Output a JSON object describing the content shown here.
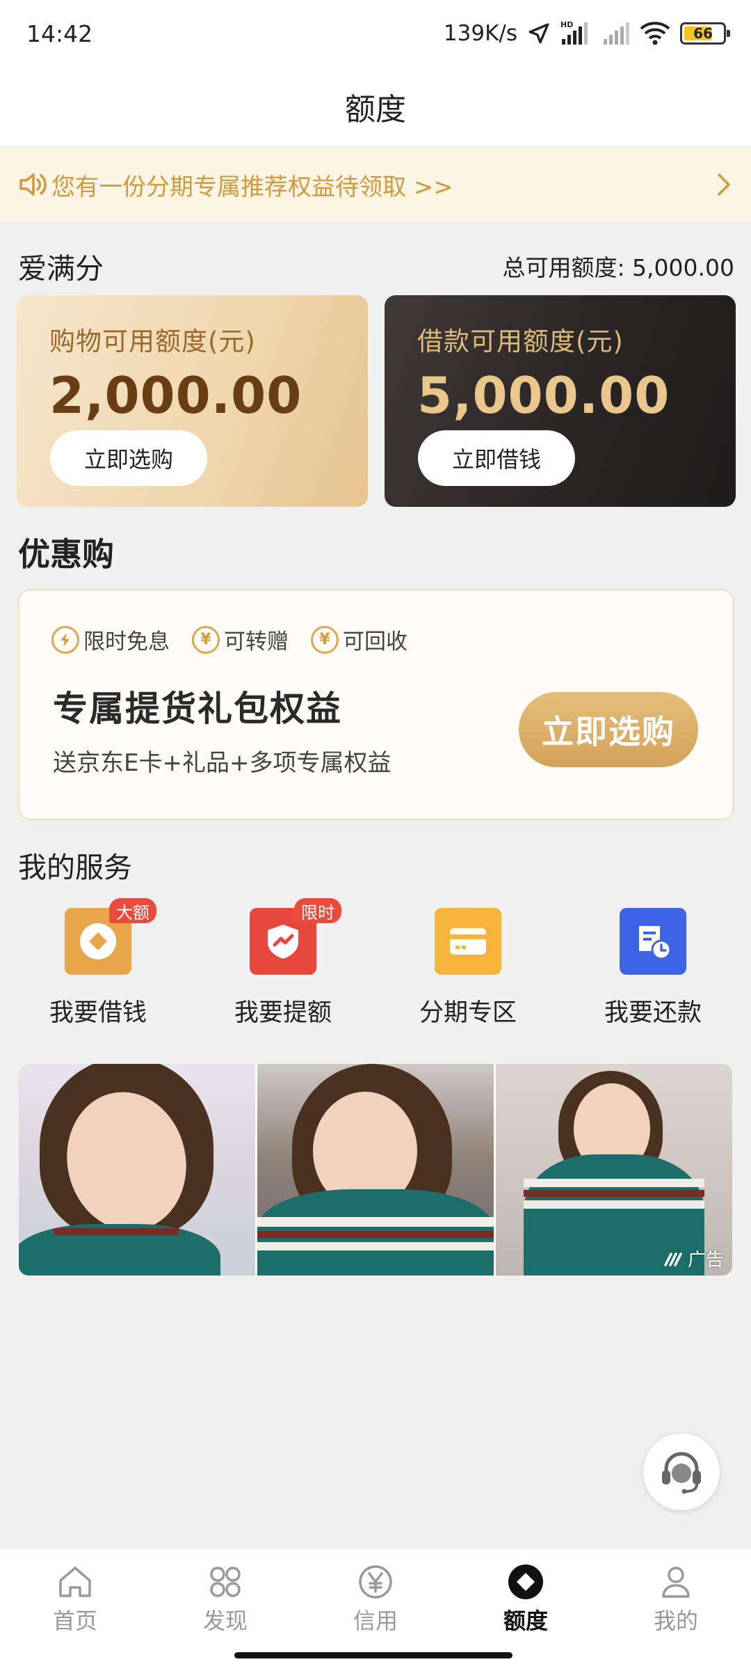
{
  "status_bar": {
    "time": "14:42",
    "net_speed": "139K/s",
    "hd": "HD",
    "battery": "66"
  },
  "header": {
    "title": "额度"
  },
  "notice": {
    "text": "您有一份分期专属推荐权益待领取 >>"
  },
  "score": {
    "title": "爱满分",
    "total_label": "总可用额度: 5,000.00"
  },
  "cards": {
    "shopping": {
      "label": "购物可用额度(元)",
      "amount": "2,000.00",
      "button": "立即选购"
    },
    "loan": {
      "label": "借款可用额度(元)",
      "amount": "5,000.00",
      "button": "立即借钱"
    }
  },
  "discount": {
    "section_title": "优惠购",
    "tags": [
      {
        "icon": "lightning-icon",
        "label": "限时免息"
      },
      {
        "icon": "yen-coin-icon",
        "label": "可转赠"
      },
      {
        "icon": "yen-coin-icon",
        "label": "可回收"
      }
    ],
    "title": "专属提货礼包权益",
    "subtitle": "送京东E卡+礼品+多项专属权益",
    "button": "立即选购"
  },
  "services": {
    "section_title": "我的服务",
    "items": [
      {
        "label": "我要借钱",
        "badge": "大额",
        "icon": "borrow-icon",
        "color": "#e8a64a"
      },
      {
        "label": "我要提额",
        "badge": "限时",
        "icon": "raise-limit-icon",
        "color": "#e8473e"
      },
      {
        "label": "分期专区",
        "badge": "",
        "icon": "installment-card-icon",
        "color": "#f6b53a"
      },
      {
        "label": "我要还款",
        "badge": "",
        "icon": "repay-bill-icon",
        "color": "#3f63e6"
      }
    ]
  },
  "ad": {
    "mark": "广告"
  },
  "tabbar": {
    "items": [
      {
        "label": "首页",
        "icon": "home-icon",
        "active": false
      },
      {
        "label": "发现",
        "icon": "discover-grid-icon",
        "active": false
      },
      {
        "label": "信用",
        "icon": "credit-yen-icon",
        "active": false
      },
      {
        "label": "额度",
        "icon": "limit-diamond-icon",
        "active": true
      },
      {
        "label": "我的",
        "icon": "profile-icon",
        "active": false
      }
    ]
  },
  "colors": {
    "accent_gold": "#d29a3f",
    "notice_bg": "#fdf5e4",
    "badge_red": "#e94b3c"
  }
}
